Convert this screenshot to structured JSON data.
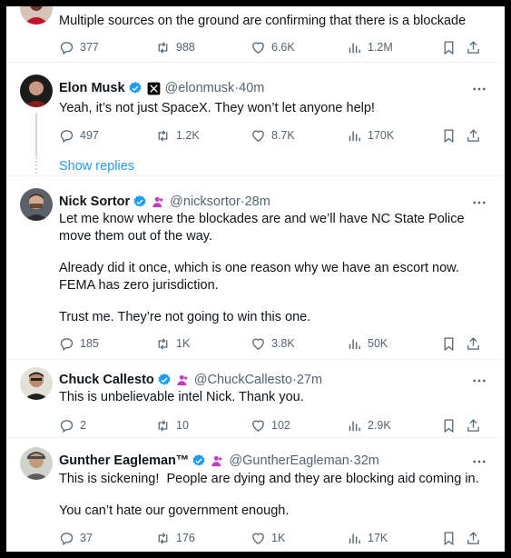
{
  "colors": {
    "accent": "#1d9bf0",
    "text": "#0f1419",
    "muted": "#536471",
    "affiliate": "#c13ebf"
  },
  "top_post": {
    "text": "Multiple sources on the ground are confirming that there is a blockade",
    "replies": "377",
    "reposts": "988",
    "likes": "6.6K",
    "views": "1.2M"
  },
  "posts": [
    {
      "name": "Elon Musk",
      "handle": "@elonmusk",
      "time": "40m",
      "affiliate_icon": "x-logo-icon",
      "paragraphs": [
        "Yeah, it’s not just SpaceX. They won’t let anyone help!"
      ],
      "replies": "497",
      "reposts": "1.2K",
      "likes": "8.7K",
      "views": "170K"
    },
    {
      "name": "Nick Sortor",
      "handle": "@nicksortor",
      "time": "28m",
      "affiliate_icon": "user-affiliate-icon",
      "paragraphs": [
        "Let me know where the blockades are and we’ll have NC State Police move them out of the way.",
        "Already did it once, which is one reason why we have an escort now. FEMA has zero jurisdiction.",
        "Trust me. They’re not going to win this one."
      ],
      "replies": "185",
      "reposts": "1K",
      "likes": "3.8K",
      "views": "50K"
    },
    {
      "name": "Chuck Callesto",
      "handle": "@ChuckCallesto",
      "time": "27m",
      "affiliate_icon": "user-affiliate-icon",
      "paragraphs": [
        "This is unbelievable intel Nick. Thank you."
      ],
      "replies": "2",
      "reposts": "10",
      "likes": "102",
      "views": "2.9K"
    },
    {
      "name": "Gunther Eagleman™",
      "handle": "@GuntherEagleman",
      "time": "32m",
      "affiliate_icon": "user-affiliate-icon",
      "paragraphs": [
        "This is sickening!  People are dying and they are blocking aid coming in.",
        "You can’t hate our government enough."
      ],
      "replies": "37",
      "reposts": "176",
      "likes": "1K",
      "views": "17K"
    }
  ],
  "show_replies": "Show replies",
  "separator": " · "
}
